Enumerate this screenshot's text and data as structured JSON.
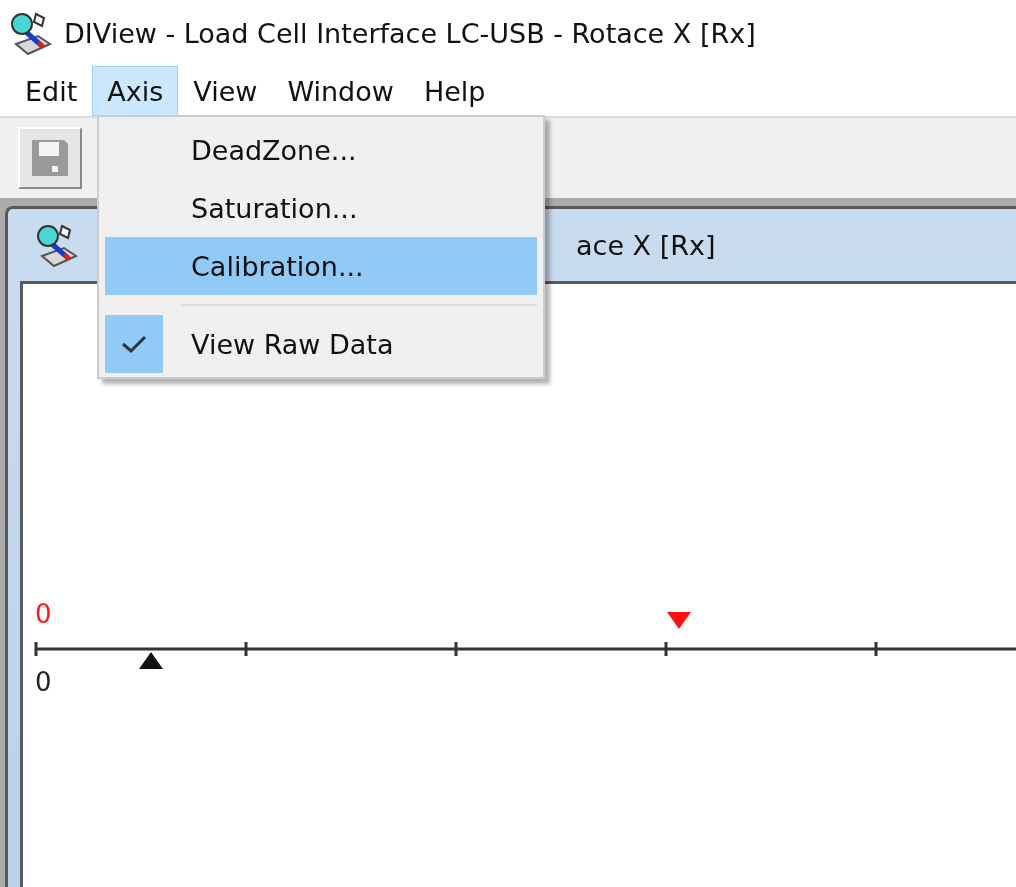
{
  "window": {
    "title": "DIView - Load Cell Interface LC-USB - Rotace X [Rx]"
  },
  "menu_bar": [
    {
      "label": "Edit",
      "selected": false
    },
    {
      "label": "Axis",
      "selected": true
    },
    {
      "label": "View",
      "selected": false
    },
    {
      "label": "Window",
      "selected": false
    },
    {
      "label": "Help",
      "selected": false
    }
  ],
  "toolbar": {
    "buttons": [
      {
        "kind": "save",
        "disabled": true
      }
    ]
  },
  "child_window": {
    "title": "ace X [Rx]",
    "scale": {
      "top_label": "0",
      "bottom_label": "0"
    }
  },
  "axis_menu": [
    {
      "kind": "item",
      "label": "DeadZone...",
      "selected": false,
      "checked": false
    },
    {
      "kind": "item",
      "label": "Saturation...",
      "selected": false,
      "checked": false
    },
    {
      "kind": "item",
      "label": "Calibration...",
      "selected": true,
      "checked": false
    },
    {
      "kind": "separator"
    },
    {
      "kind": "item",
      "label": "View Raw Data",
      "selected": false,
      "checked": true
    }
  ]
}
